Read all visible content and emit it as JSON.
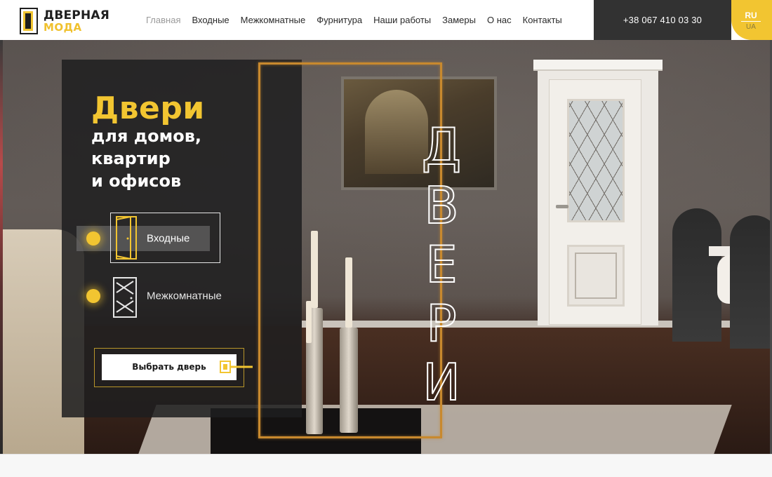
{
  "header": {
    "logo": {
      "line1": "ДВЕРНАЯ",
      "line2": "МОДА"
    },
    "nav": [
      {
        "label": "Главная",
        "active": true
      },
      {
        "label": "Входные",
        "active": false
      },
      {
        "label": "Межкомнатные",
        "active": false
      },
      {
        "label": "Фурнитура",
        "active": false
      },
      {
        "label": "Наши работы",
        "active": false
      },
      {
        "label": "Замеры",
        "active": false
      },
      {
        "label": "О нас",
        "active": false
      },
      {
        "label": "Контакты",
        "active": false
      }
    ],
    "phone": "+38 067 410 03 30",
    "languages": {
      "current": "RU",
      "alternate": "UA"
    }
  },
  "hero": {
    "title": "Двери",
    "subtitle_lines": [
      "для домов,",
      "квартир",
      "и офисов"
    ],
    "categories": [
      {
        "label": "Входные",
        "icon": "entrance-door-icon"
      },
      {
        "label": "Межкомнатные",
        "icon": "interior-door-icon"
      }
    ],
    "cta_label": "Выбрать дверь",
    "vertical_letters": [
      "Д",
      "В",
      "Е",
      "Р",
      "И"
    ]
  },
  "colors": {
    "accent": "#f2c531",
    "dark": "#323232",
    "gold_frame": "#c8892e"
  }
}
